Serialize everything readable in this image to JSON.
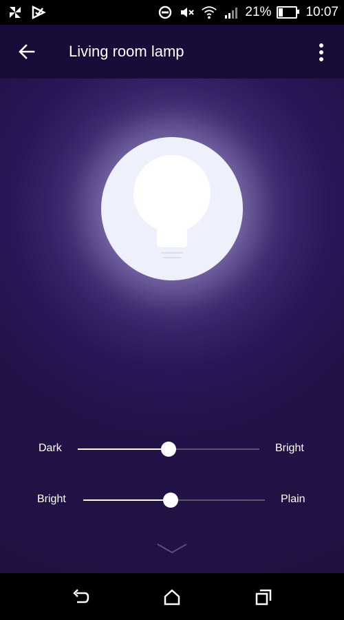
{
  "status_bar": {
    "battery_percent": "21%",
    "battery_level": 0.21,
    "time": "10:07",
    "icons": [
      "pinwheel-icon",
      "vpn-check-icon",
      "do-not-disturb-icon",
      "mute-icon",
      "wifi-icon",
      "signal-icon",
      "battery-icon"
    ]
  },
  "app_bar": {
    "title": "Living room lamp",
    "back_icon": "arrow-left-icon",
    "menu_icon": "more-vert-icon"
  },
  "lamp": {
    "icon": "lightbulb-icon"
  },
  "sliders": [
    {
      "left_label": "Dark",
      "right_label": "Bright",
      "value": 0.5
    },
    {
      "left_label": "Bright",
      "right_label": "Plain",
      "value": 0.48
    }
  ],
  "expand_icon": "chevron-down-icon",
  "nav_bar": {
    "buttons": [
      "back-nav-icon",
      "home-nav-icon",
      "recents-nav-icon"
    ]
  },
  "colors": {
    "background": "#24124a",
    "app_bar": "#1a0c38",
    "bulb_circle": "#eef0fb",
    "accent": "#ffffff"
  }
}
